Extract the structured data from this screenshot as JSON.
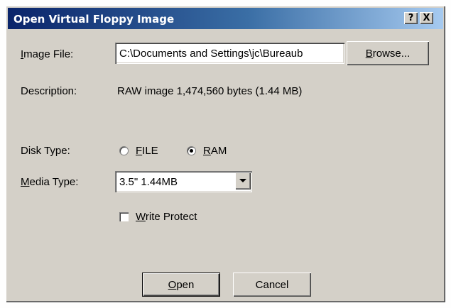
{
  "window": {
    "title": "Open Virtual Floppy Image",
    "help_label": "?",
    "close_label": "X"
  },
  "image_file": {
    "label_mnemonic": "I",
    "label_rest": "mage File:",
    "value": "C:\\Documents and Settings\\jc\\Bureaub",
    "browse_mnemonic": "B",
    "browse_rest": "rowse..."
  },
  "description": {
    "label": "Description:",
    "value": "RAW image 1,474,560 bytes (1.44 MB)"
  },
  "disk_type": {
    "label": "Disk Type:",
    "options": [
      {
        "mnemonic": "F",
        "rest": "ILE",
        "selected": false
      },
      {
        "mnemonic": "R",
        "rest": "AM",
        "selected": true
      }
    ]
  },
  "media_type": {
    "label_mnemonic": "M",
    "label_rest": "edia Type:",
    "selected": "3.5\"  1.44MB"
  },
  "write_protect": {
    "label_mnemonic": "W",
    "label_rest": "rite Protect",
    "checked": false
  },
  "buttons": {
    "open_mnemonic": "O",
    "open_rest": "pen",
    "cancel": "Cancel"
  }
}
